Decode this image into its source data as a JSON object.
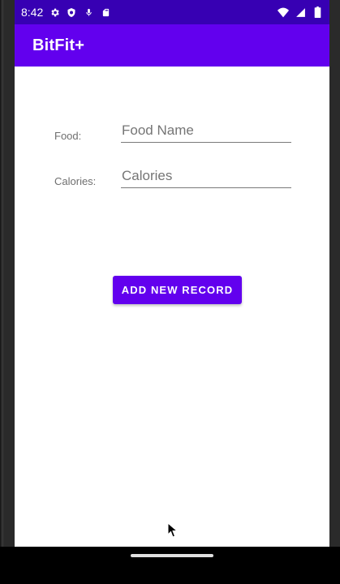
{
  "status_bar": {
    "time": "8:42",
    "left_icons": [
      "settings-icon",
      "shield-icon",
      "microphone-icon",
      "sd-card-icon"
    ],
    "right_icons": [
      "wifi-icon",
      "signal-icon",
      "battery-icon"
    ]
  },
  "app_bar": {
    "title": "BitFit+"
  },
  "form": {
    "food_label": "Food:",
    "food_placeholder": "Food Name",
    "food_value": "",
    "calories_label": "Calories:",
    "calories_placeholder": "Calories",
    "calories_value": ""
  },
  "actions": {
    "add_button_label": "ADD NEW RECORD"
  },
  "colors": {
    "status_bar": "#3700b3",
    "primary": "#6200ee",
    "background": "#ffffff"
  }
}
